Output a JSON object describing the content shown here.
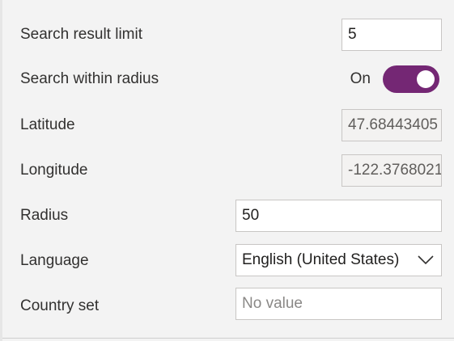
{
  "settings": {
    "search_result_limit": {
      "label": "Search result limit",
      "value": "5"
    },
    "search_within_radius": {
      "label": "Search within radius",
      "state_label": "On",
      "enabled": true
    },
    "latitude": {
      "label": "Latitude",
      "value": "47.68443405"
    },
    "longitude": {
      "label": "Longitude",
      "value": "-122.3768021"
    },
    "radius": {
      "label": "Radius",
      "value": "50"
    },
    "language": {
      "label": "Language",
      "selected": "English (United States)"
    },
    "country_set": {
      "label": "Country set",
      "placeholder": "No value"
    }
  },
  "colors": {
    "accent": "#742774"
  },
  "icons": {
    "language_dropdown": "chevron-down-icon"
  }
}
